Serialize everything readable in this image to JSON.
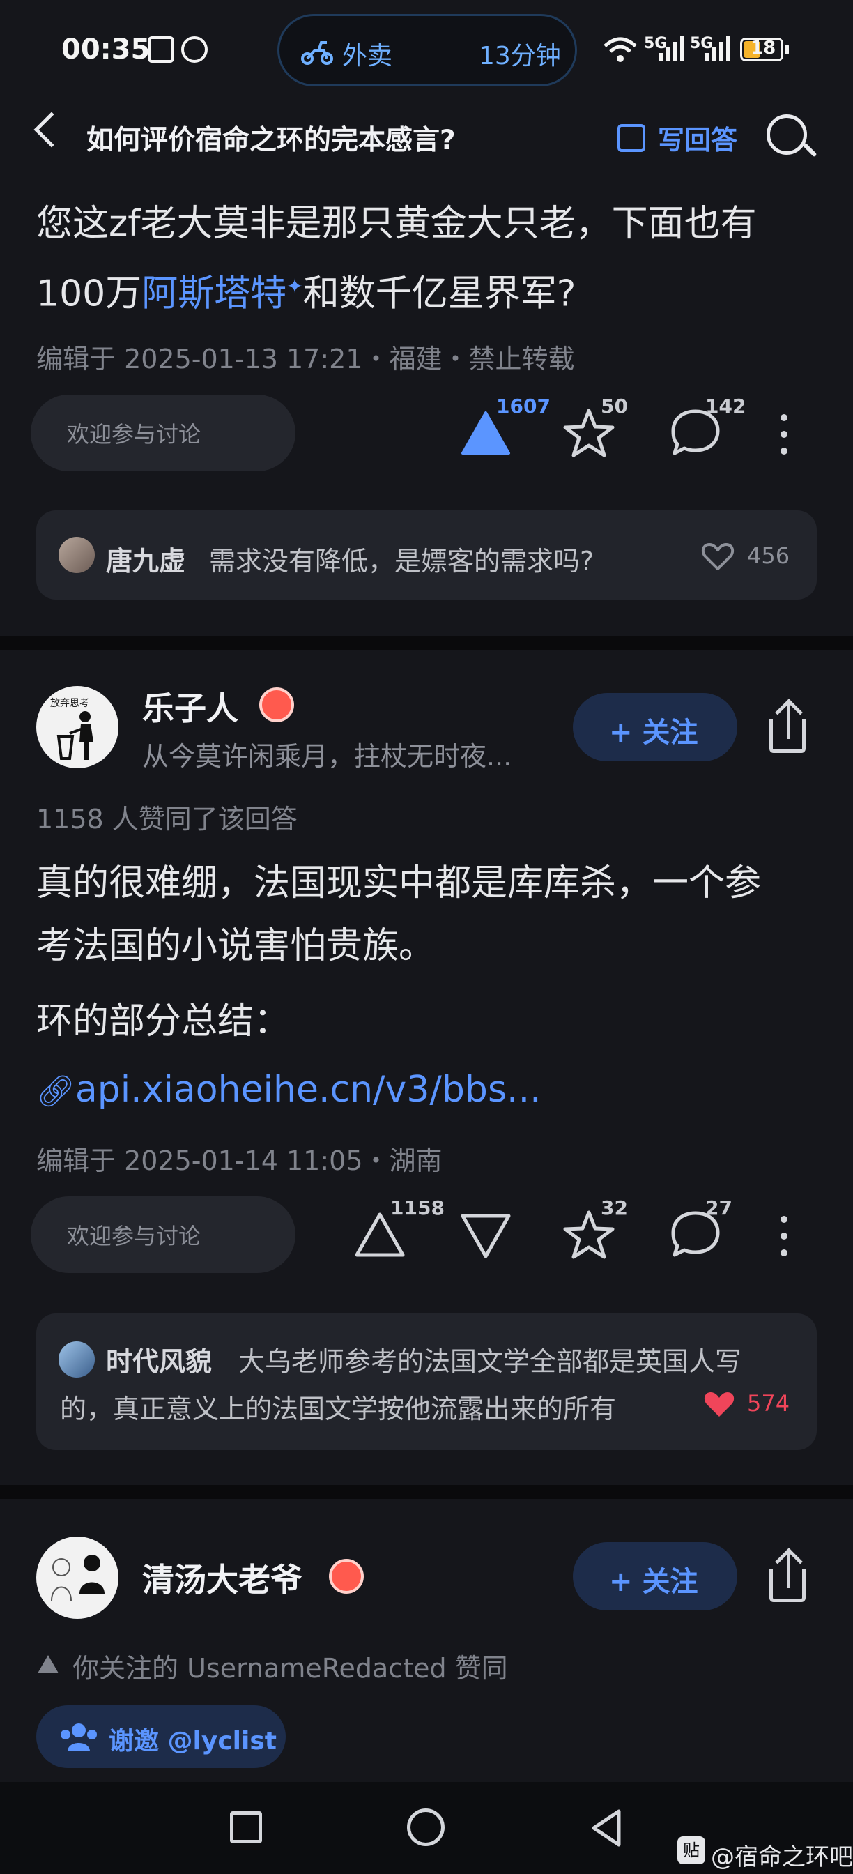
{
  "status_bar": {
    "time": "00:35",
    "pill_label": "外卖",
    "pill_time": "13分钟",
    "net1": "5G",
    "net2": "5G",
    "battery": "18"
  },
  "header": {
    "title": "如何评价宿命之环的完本感言?",
    "write_label": "写回答"
  },
  "answer1": {
    "text_line1": "您这zf老大莫非是那只黄金大只老，下面也有",
    "text_line2_pre": "100万",
    "text_line2_link": "阿斯塔特",
    "text_line2_post": "和数千亿星界军?",
    "meta": "编辑于 2025-01-13 17:21・福建・禁止转载",
    "discuss_placeholder": "欢迎参与讨论",
    "upvotes": "1607",
    "favorites": "50",
    "comments": "142",
    "top_comment": {
      "name": "唐九虚",
      "text": "需求没有降低，是嫖客的需求吗?",
      "likes": "456"
    }
  },
  "answer2": {
    "author": "乐子人",
    "avatar_caption": "放弃思考",
    "bio": "从今莫许闲乘月，拄杖无时夜...",
    "follow_label": "+ 关注",
    "approvals": "1158 人赞同了该回答",
    "text_line1": "真的很难绷，法国现实中都是库库杀，一个参",
    "text_line2": "考法国的小说害怕贵族。",
    "text_line3": "环的部分总结：",
    "link": "api.xiaoheihe.cn/v3/bbs...",
    "meta": "编辑于 2025-01-14 11:05・湖南",
    "discuss_placeholder": "欢迎参与讨论",
    "upvotes": "1158",
    "favorites": "32",
    "comments": "27",
    "top_comment": {
      "name": "时代风貌",
      "text_line1": "大乌老师参考的法国文学全部都是英国人写",
      "text_line2": "的，真正意义上的法国文学按他流露出来的所有",
      "likes": "574"
    }
  },
  "answer3": {
    "author": "清汤大老爷",
    "follow_label": "+ 关注",
    "notice": "你关注的 UsernameRedacted 赞同",
    "invite_label": "谢邀 @lyclist"
  },
  "watermark": {
    "badge": "贴",
    "text": "@宿命之环吧"
  },
  "colors": {
    "accent": "#5b95ff",
    "heart": "#f0455a",
    "background": "#15161b"
  }
}
